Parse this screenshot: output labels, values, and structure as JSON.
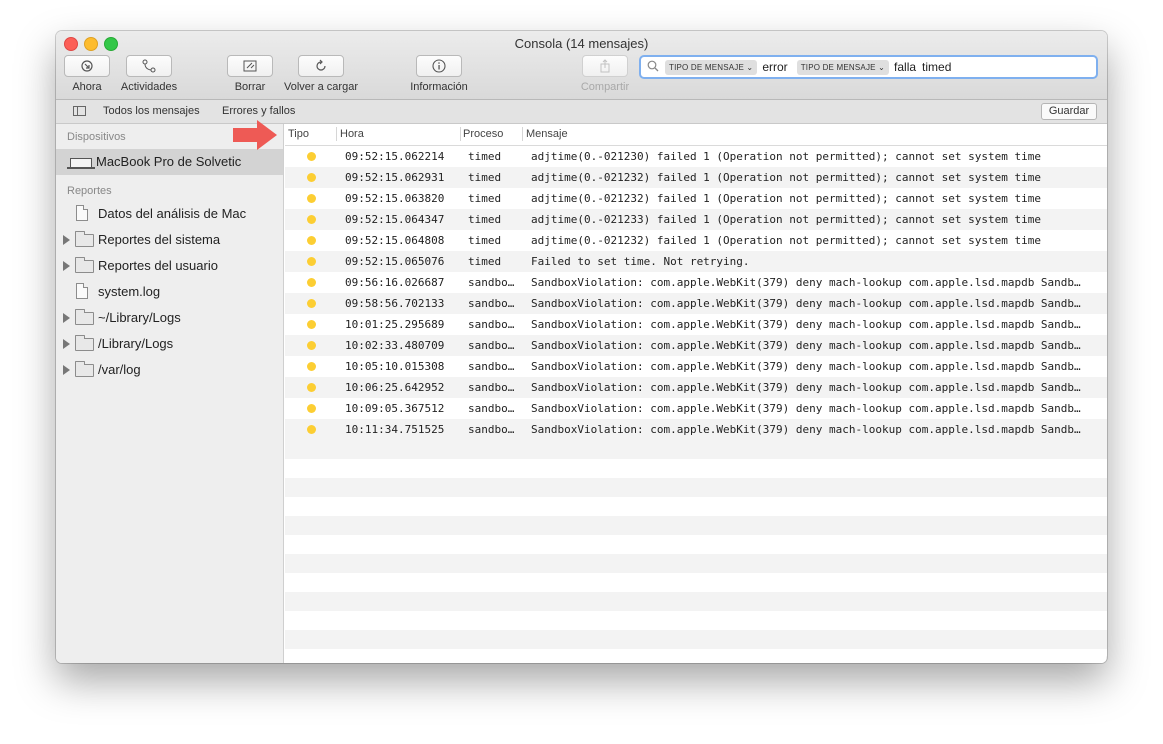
{
  "window": {
    "title": "Consola (14 mensajes)"
  },
  "toolbar": {
    "ahora": "Ahora",
    "actividades": "Actividades",
    "borrar": "Borrar",
    "volver": "Volver a cargar",
    "informacion": "Información",
    "compartir": "Compartir"
  },
  "search": {
    "tokens": [
      {
        "type": "TIPO DE MENSAJE ⌄",
        "value": "error"
      },
      {
        "type": "TIPO DE MENSAJE ⌄",
        "value": "falla"
      }
    ],
    "text": "timed"
  },
  "filterbar": {
    "all": "Todos los mensajes",
    "errors": "Errores y fallos",
    "save": "Guardar"
  },
  "sidebar": {
    "devices_header": "Dispositivos",
    "device": "MacBook Pro de Solvetic",
    "reports_header": "Reportes",
    "items": [
      {
        "label": "Datos del análisis de Mac",
        "kind": "doc"
      },
      {
        "label": "Reportes del sistema",
        "kind": "folder"
      },
      {
        "label": "Reportes del usuario",
        "kind": "folder"
      },
      {
        "label": "system.log",
        "kind": "doc"
      },
      {
        "label": "~/Library/Logs",
        "kind": "folder"
      },
      {
        "label": "/Library/Logs",
        "kind": "folder"
      },
      {
        "label": "/var/log",
        "kind": "folder"
      }
    ]
  },
  "table": {
    "columns": {
      "tipo": "Tipo",
      "hora": "Hora",
      "proceso": "Proceso",
      "mensaje": "Mensaje"
    },
    "type_color": "#fcce33",
    "rows": [
      {
        "hora": "09:52:15.062214",
        "proceso": "timed",
        "mensaje": "adjtime(0.-021230) failed 1 (Operation not permitted); cannot set system time"
      },
      {
        "hora": "09:52:15.062931",
        "proceso": "timed",
        "mensaje": "adjtime(0.-021232) failed 1 (Operation not permitted); cannot set system time"
      },
      {
        "hora": "09:52:15.063820",
        "proceso": "timed",
        "mensaje": "adjtime(0.-021232) failed 1 (Operation not permitted); cannot set system time"
      },
      {
        "hora": "09:52:15.064347",
        "proceso": "timed",
        "mensaje": "adjtime(0.-021233) failed 1 (Operation not permitted); cannot set system time"
      },
      {
        "hora": "09:52:15.064808",
        "proceso": "timed",
        "mensaje": "adjtime(0.-021232) failed 1 (Operation not permitted); cannot set system time"
      },
      {
        "hora": "09:52:15.065076",
        "proceso": "timed",
        "mensaje": "Failed to set time. Not retrying."
      },
      {
        "hora": "09:56:16.026687",
        "proceso": "sandbo…",
        "mensaje": "SandboxViolation: com.apple.WebKit(379) deny mach-lookup com.apple.lsd.mapdb Sandb…"
      },
      {
        "hora": "09:58:56.702133",
        "proceso": "sandbo…",
        "mensaje": "SandboxViolation: com.apple.WebKit(379) deny mach-lookup com.apple.lsd.mapdb Sandb…"
      },
      {
        "hora": "10:01:25.295689",
        "proceso": "sandbo…",
        "mensaje": "SandboxViolation: com.apple.WebKit(379) deny mach-lookup com.apple.lsd.mapdb Sandb…"
      },
      {
        "hora": "10:02:33.480709",
        "proceso": "sandbo…",
        "mensaje": "SandboxViolation: com.apple.WebKit(379) deny mach-lookup com.apple.lsd.mapdb Sandb…"
      },
      {
        "hora": "10:05:10.015308",
        "proceso": "sandbo…",
        "mensaje": "SandboxViolation: com.apple.WebKit(379) deny mach-lookup com.apple.lsd.mapdb Sandb…"
      },
      {
        "hora": "10:06:25.642952",
        "proceso": "sandbo…",
        "mensaje": "SandboxViolation: com.apple.WebKit(379) deny mach-lookup com.apple.lsd.mapdb Sandb…"
      },
      {
        "hora": "10:09:05.367512",
        "proceso": "sandbo…",
        "mensaje": "SandboxViolation: com.apple.WebKit(379) deny mach-lookup com.apple.lsd.mapdb Sandb…"
      },
      {
        "hora": "10:11:34.751525",
        "proceso": "sandbo…",
        "mensaje": "SandboxViolation: com.apple.WebKit(379) deny mach-lookup com.apple.lsd.mapdb Sandb…"
      }
    ]
  },
  "annotation": {
    "arrow_color": "#ee5a55"
  }
}
